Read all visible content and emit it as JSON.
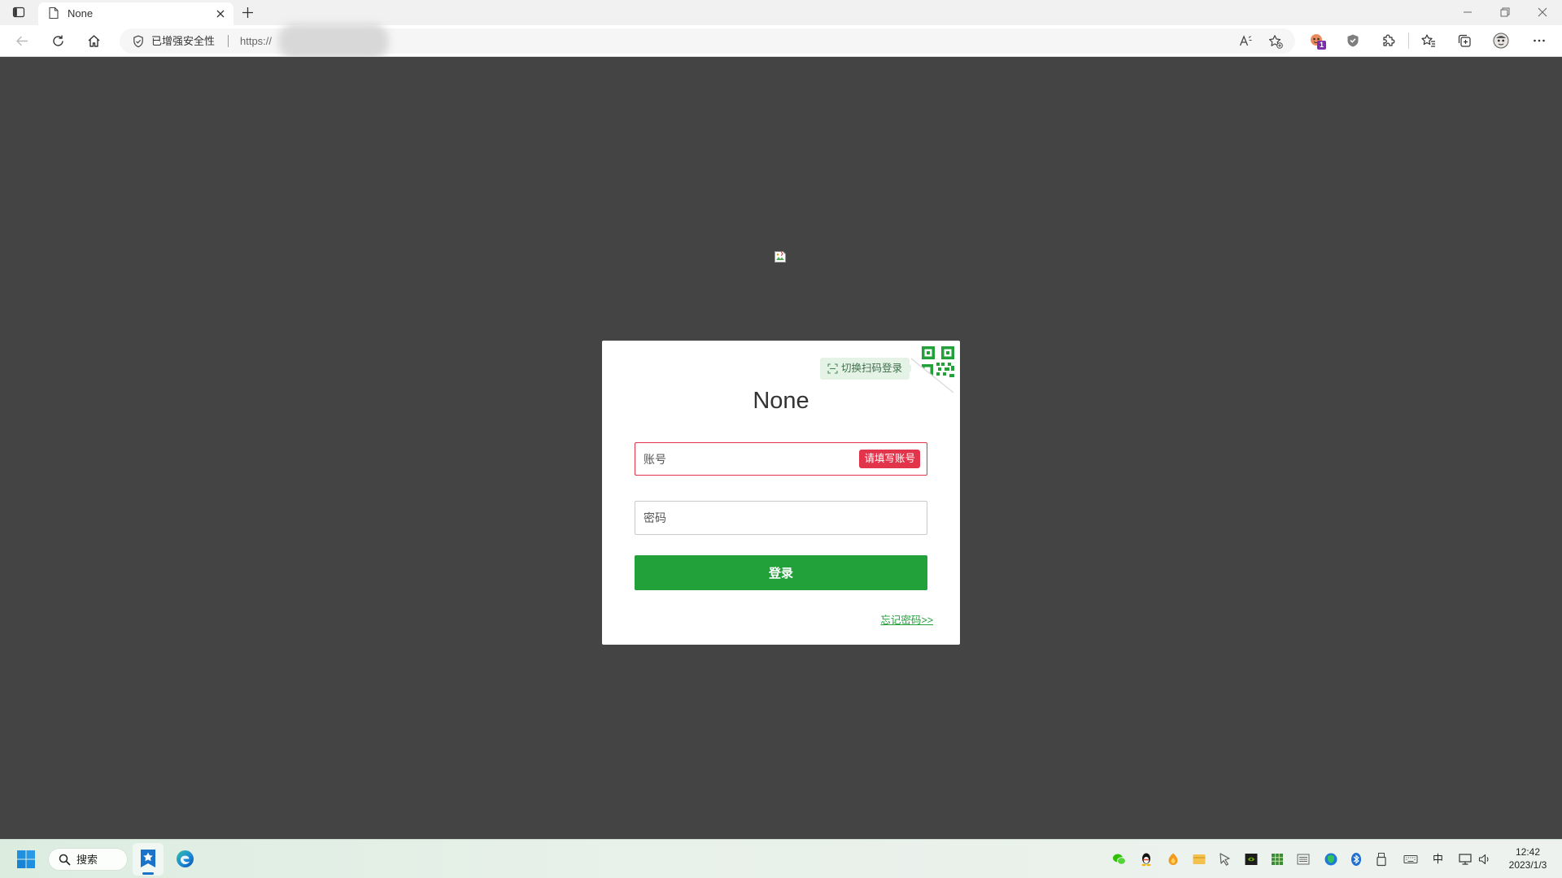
{
  "browser": {
    "tab": {
      "title": "None"
    },
    "address_bar": {
      "security_label": "已增强安全性",
      "url": "https://"
    },
    "extension_badge": "1"
  },
  "login": {
    "qr_switch_label": "切换扫码登录",
    "title": "None",
    "account": {
      "placeholder": "账号",
      "error": "请填写账号"
    },
    "password": {
      "placeholder": "密码"
    },
    "submit_label": "登录",
    "forgot_password_label": "忘记密码>>"
  },
  "taskbar": {
    "search_label": "搜索",
    "ime_indicator": "中",
    "time": "12:42",
    "date": "2023/1/3"
  },
  "icons": [
    "tab-actions-icon",
    "page-icon",
    "close-icon",
    "plus-icon",
    "minimize-icon",
    "restore-icon",
    "back-icon",
    "refresh-icon",
    "home-icon",
    "shield-icon",
    "read-aloud-icon",
    "add-favorite-icon",
    "extension-icon",
    "adblock-shield-icon",
    "puzzle-icon",
    "favorites-icon",
    "collections-icon",
    "profile-avatar-icon",
    "more-icon",
    "broken-image-icon",
    "scan-icon",
    "qr-code-icon",
    "windows-start-icon",
    "search-icon",
    "edge-icon",
    "wechat-icon",
    "qq-icon",
    "bluetooth-icon",
    "network-icon",
    "volume-icon"
  ],
  "theme": {
    "page_background": "#444444",
    "accent": "#22a039",
    "error": "#e2354b",
    "card_background": "#ffffff"
  }
}
